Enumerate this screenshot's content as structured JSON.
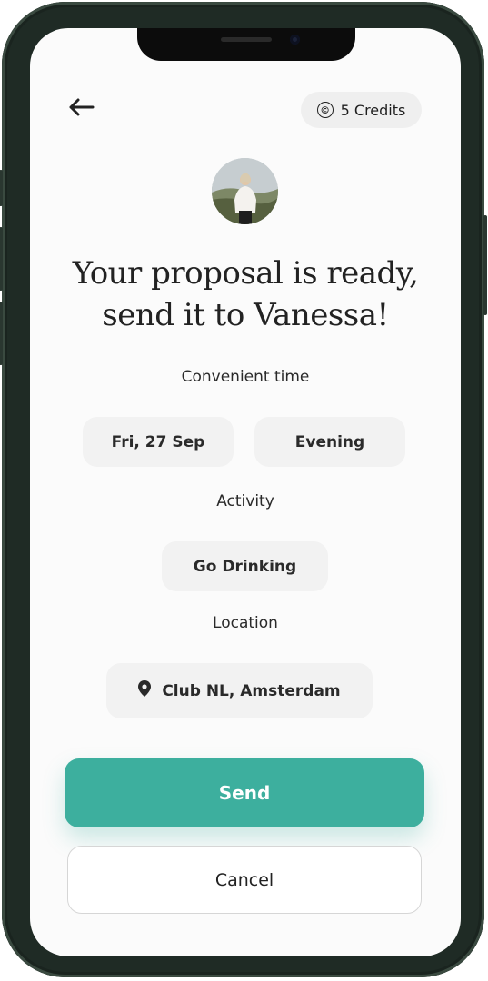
{
  "header": {
    "back_icon": "arrow-left-icon",
    "credits_icon": "copyright-icon",
    "credits_symbol": "©",
    "credits_label": "5 Credits"
  },
  "profile": {
    "avatar_icon": "profile-photo"
  },
  "title": {
    "line1": "Your proposal is ready,",
    "line2": "send it to Vanessa!"
  },
  "time": {
    "label": "Convenient time",
    "date": "Fri, 27 Sep",
    "period": "Evening"
  },
  "activity": {
    "label": "Activity",
    "value": "Go Drinking"
  },
  "location": {
    "label": "Location",
    "icon": "map-pin-icon",
    "value": "Club NL, Amsterdam"
  },
  "actions": {
    "send_label": "Send",
    "cancel_label": "Cancel"
  },
  "colors": {
    "accent": "#3daf9e",
    "chip_bg": "#f2f2f2",
    "screen_bg": "#fbfbfb",
    "frame": "#1f2b25"
  }
}
